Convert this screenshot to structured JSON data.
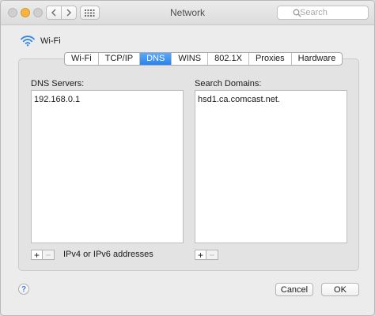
{
  "window": {
    "title": "Network",
    "search_placeholder": "Search"
  },
  "header": {
    "interface_name": "Wi-Fi"
  },
  "tabs": [
    {
      "label": "Wi-Fi",
      "active": false
    },
    {
      "label": "TCP/IP",
      "active": false
    },
    {
      "label": "DNS",
      "active": true
    },
    {
      "label": "WINS",
      "active": false
    },
    {
      "label": "802.1X",
      "active": false
    },
    {
      "label": "Proxies",
      "active": false
    },
    {
      "label": "Hardware",
      "active": false
    }
  ],
  "dns_servers": {
    "label": "DNS Servers:",
    "items": [
      "192.168.0.1"
    ],
    "hint": "IPv4 or IPv6 addresses"
  },
  "search_domains": {
    "label": "Search Domains:",
    "items": [
      "hsd1.ca.comcast.net."
    ]
  },
  "controls": {
    "add_symbol": "+",
    "remove_symbol": "−",
    "help_symbol": "?"
  },
  "footer": {
    "cancel_label": "Cancel",
    "ok_label": "OK"
  },
  "colors": {
    "accent": "#2a82ee",
    "wifi_icon": "#2f86e8"
  }
}
